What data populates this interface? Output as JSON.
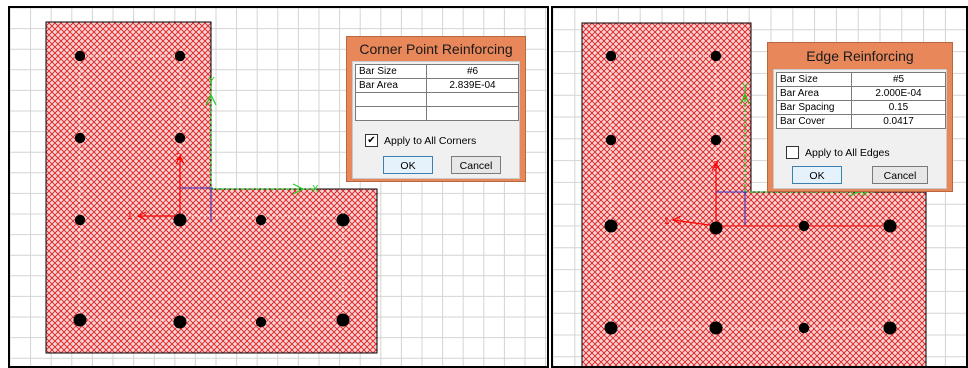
{
  "panels": [
    {
      "id": "corner",
      "dialog": {
        "title": "Corner Point Reinforcing",
        "rows": [
          {
            "label": "Bar Size",
            "value": "#6"
          },
          {
            "label": "Bar Area",
            "value": "2.839E-04"
          },
          {
            "label": "",
            "value": ""
          },
          {
            "label": "",
            "value": ""
          }
        ],
        "checkbox_label": "Apply to All Corners",
        "checkbox_checked": true,
        "ok_label": "OK",
        "cancel_label": "Cancel"
      },
      "axis_labels": {
        "one": "1",
        "two": "2",
        "x": "X",
        "y": "Y"
      }
    },
    {
      "id": "edge",
      "dialog": {
        "title": "Edge Reinforcing",
        "rows": [
          {
            "label": "Bar Size",
            "value": "#5"
          },
          {
            "label": "Bar Area",
            "value": "2.000E-04"
          },
          {
            "label": "Bar Spacing",
            "value": "0.15"
          },
          {
            "label": "Bar Cover",
            "value": "0.0417"
          }
        ],
        "checkbox_label": "Apply to All Edges",
        "checkbox_checked": false,
        "ok_label": "OK",
        "cancel_label": "Cancel"
      },
      "axis_labels": {
        "one": "1",
        "two": "2",
        "x": "X",
        "y": "Y"
      }
    }
  ],
  "colors": {
    "grid": "#d4d4d4",
    "hatch": "#e02020",
    "hatch_bg": "#f6d2d2",
    "bar": "#000000",
    "dialog_frame": "#e8875a",
    "local_axis": "#ff0000",
    "global_axis": "#22cc22",
    "column_axis": "#3333cc"
  },
  "icons": [
    "checkbox-checked-icon",
    "checkbox-unchecked-icon"
  ]
}
